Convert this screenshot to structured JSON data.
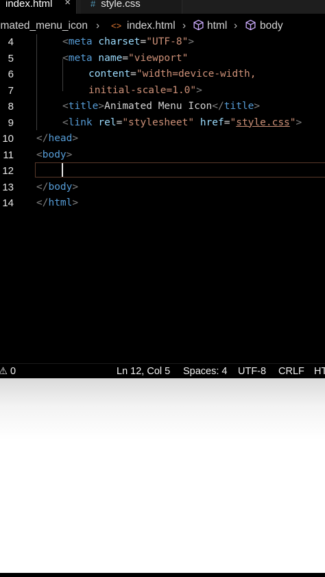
{
  "tabs": [
    {
      "label": "index.html",
      "close": "×"
    },
    {
      "label": "style.css",
      "icon": "#"
    }
  ],
  "breadcrumb": {
    "folder": "imated_menu_icon",
    "file": "index.html",
    "html": "html",
    "body": "body",
    "separator": "›",
    "tag_icon": "<>"
  },
  "code": [
    {
      "ln": "4",
      "indent": 1,
      "tokens": [
        [
          "p",
          "<"
        ],
        [
          "t",
          "meta"
        ],
        [
          "e",
          " "
        ],
        [
          "a",
          "charset"
        ],
        [
          "e",
          "="
        ],
        [
          "s",
          "\"UTF-8\""
        ],
        [
          "p",
          ">"
        ]
      ]
    },
    {
      "ln": "5",
      "indent": 1,
      "tokens": [
        [
          "p",
          "<"
        ],
        [
          "t",
          "meta"
        ],
        [
          "e",
          " "
        ],
        [
          "a",
          "name"
        ],
        [
          "e",
          "="
        ],
        [
          "s",
          "\"viewport\""
        ]
      ]
    },
    {
      "ln": "6",
      "indent": 2,
      "tokens": [
        [
          "a",
          "content"
        ],
        [
          "e",
          "="
        ],
        [
          "s",
          "\"width=device-width,"
        ]
      ]
    },
    {
      "ln": "7",
      "indent": 2,
      "tokens": [
        [
          "s",
          "initial-scale=1.0\""
        ],
        [
          "p",
          ">"
        ]
      ]
    },
    {
      "ln": "8",
      "indent": 1,
      "tokens": [
        [
          "p",
          "<"
        ],
        [
          "t",
          "title"
        ],
        [
          "p",
          ">"
        ],
        [
          "x",
          "Animated Menu Icon"
        ],
        [
          "p",
          "</"
        ],
        [
          "t",
          "title"
        ],
        [
          "p",
          ">"
        ]
      ]
    },
    {
      "ln": "9",
      "indent": 1,
      "tokens": [
        [
          "p",
          "<"
        ],
        [
          "t",
          "link"
        ],
        [
          "e",
          " "
        ],
        [
          "a",
          "rel"
        ],
        [
          "e",
          "="
        ],
        [
          "s",
          "\"stylesheet\""
        ],
        [
          "e",
          " "
        ],
        [
          "a",
          "href"
        ],
        [
          "e",
          "="
        ],
        [
          "s",
          "\""
        ],
        [
          "su",
          "style.css"
        ],
        [
          "s",
          "\""
        ],
        [
          "p",
          ">"
        ]
      ]
    },
    {
      "ln": "10",
      "indent": 0,
      "tokens": [
        [
          "p",
          "</"
        ],
        [
          "t",
          "head"
        ],
        [
          "p",
          ">"
        ]
      ]
    },
    {
      "ln": "11",
      "indent": 0,
      "tokens": [
        [
          "p",
          "<"
        ],
        [
          "t",
          "body"
        ],
        [
          "p",
          ">"
        ]
      ]
    },
    {
      "ln": "12",
      "indent": 0,
      "tokens": []
    },
    {
      "ln": "13",
      "indent": 0,
      "tokens": [
        [
          "p",
          "</"
        ],
        [
          "t",
          "body"
        ],
        [
          "p",
          ">"
        ]
      ]
    },
    {
      "ln": "14",
      "indent": 0,
      "tokens": [
        [
          "p",
          "</"
        ],
        [
          "t",
          "html"
        ],
        [
          "p",
          ">"
        ]
      ]
    }
  ],
  "status": {
    "problems": "0",
    "position": "Ln 12, Col 5",
    "spaces": "Spaces: 4",
    "encoding": "UTF-8",
    "eol": "CRLF",
    "language": "HTML"
  },
  "colors": {
    "editor_bg": "#000000",
    "tag": "#569cd6",
    "attribute": "#9cdcfe",
    "string": "#ce9178",
    "punctuation": "#808080",
    "line_highlight_border": "#5a3a2a"
  }
}
